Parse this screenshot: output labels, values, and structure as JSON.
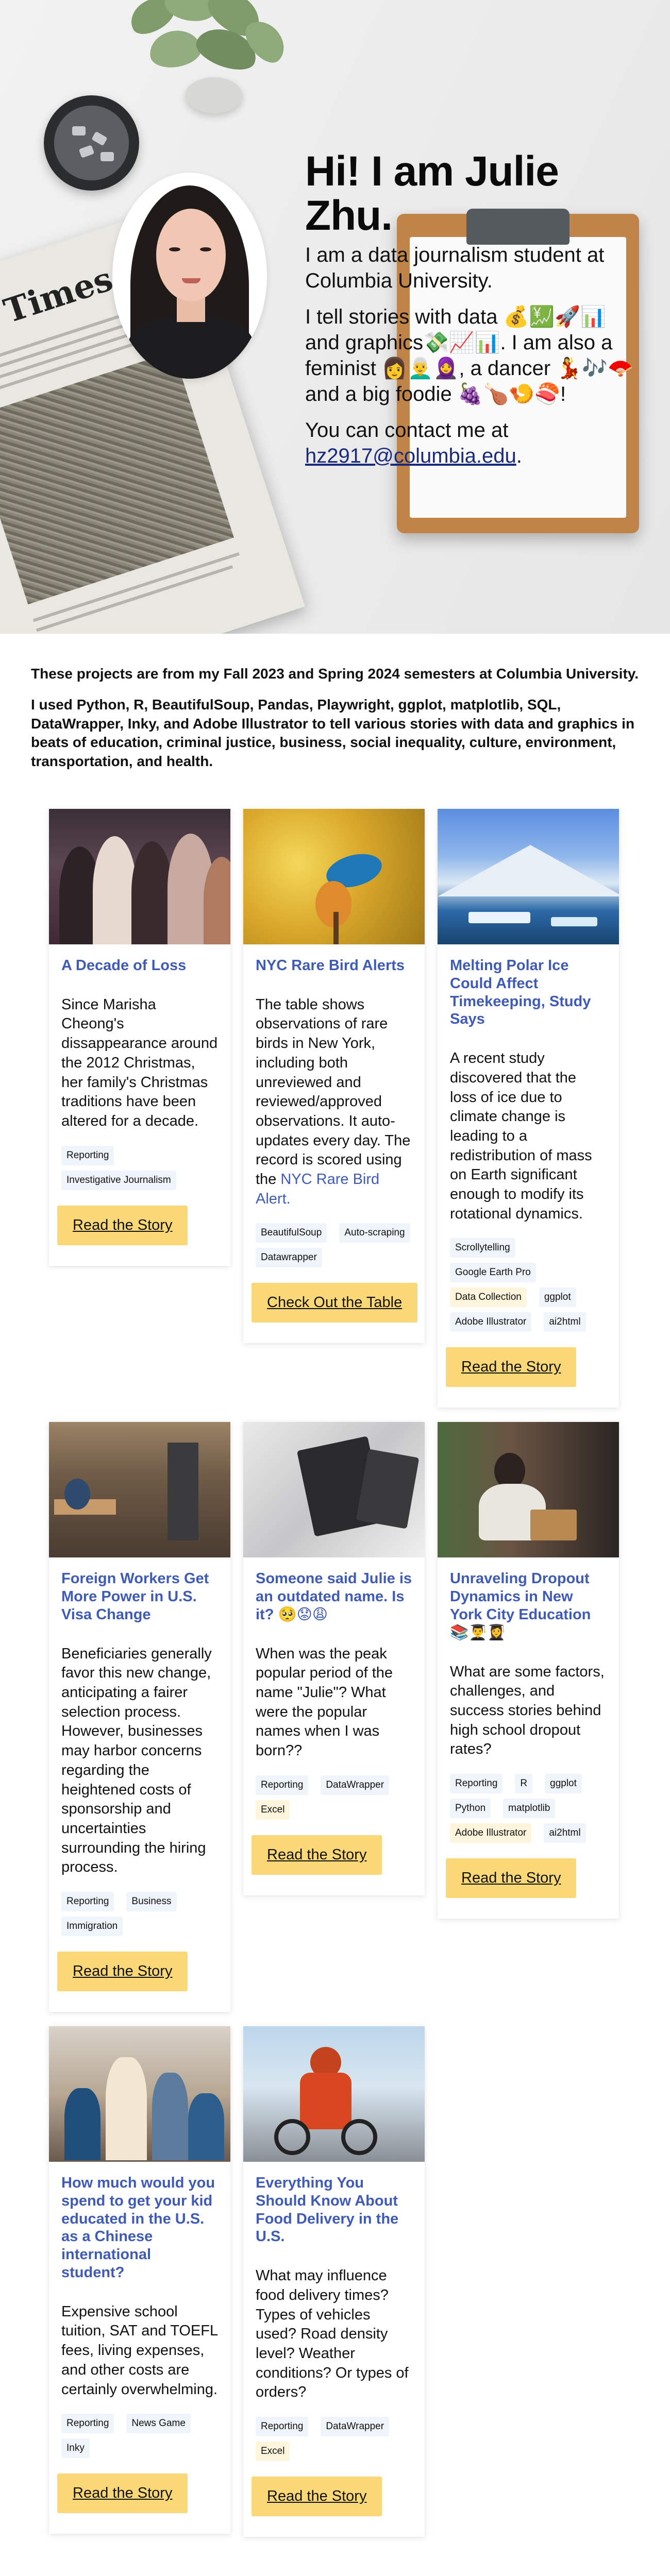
{
  "hero": {
    "heading": "Hi! I am Julie Zhu.",
    "line1": "I am a data journalism student at Columbia University.",
    "line2": "I tell stories with data 💰💹🚀📊 and graphics💸📈📊. I am also a feminist 👩👨‍🦳🧕, a dancer 💃🎶🪭 and a big foodie 🍇🍗🍤🍣!",
    "contact_prefix": "You can contact me at ",
    "email": "hz2917@columbia.edu",
    "contact_suffix": ".",
    "newspaper_masthead": "York Times"
  },
  "about": {
    "p1": "These projects are from my Fall 2023 and Spring 2024 semesters at Columbia University.",
    "p2": "I used Python, R, BeautifulSoup, Pandas, Playwright, ggplot, matplotlib, SQL, DataWrapper, Inky, and Adobe Illustrator to tell various stories with data and graphics in beats of education, criminal justice, business, social inequality, culture, environment, transportation, and health."
  },
  "cards": [
    {
      "title": "A Decade of Loss",
      "desc": "Since Marisha Cheong's dissappearance around the 2012 Christmas, her family's Christmas traditions have been altered for a decade.",
      "tags": [
        {
          "label": "Reporting",
          "color": "blue"
        },
        {
          "label": "Investigative Journalism",
          "color": "blue"
        }
      ],
      "button": "Read the Story"
    },
    {
      "title": "NYC Rare Bird Alerts",
      "desc": "The table shows observations of rare birds in New York, including both unreviewed and reviewed/approved observations. It auto-updates every day. The record is scored using the ",
      "desc_link": "NYC Rare Bird Alert.",
      "tags": [
        {
          "label": "BeautifulSoup",
          "color": "blue"
        },
        {
          "label": "Auto-scraping",
          "color": "blue"
        },
        {
          "label": "Datawrapper",
          "color": "blue"
        }
      ],
      "button": "Check Out the Table"
    },
    {
      "title": "Melting Polar Ice Could Affect Timekeeping, Study Says",
      "desc": "A recent study discovered that the loss of ice due to climate change is leading to a redistribution of mass on Earth significant enough to modify its rotational dynamics.",
      "tags": [
        {
          "label": "Scrollytelling",
          "color": "blue"
        },
        {
          "label": "Google Earth Pro",
          "color": "blue"
        },
        {
          "label": "Data Collection",
          "color": "yellow"
        },
        {
          "label": "ggplot",
          "color": "blue"
        },
        {
          "label": "Adobe Illustrator",
          "color": "blue"
        },
        {
          "label": "ai2html",
          "color": "blue"
        }
      ],
      "button": "Read the Story"
    },
    {
      "title": "Foreign Workers Get More Power in U.S. Visa Change",
      "desc": "Beneficiaries generally favor this new change, anticipating a fairer selection process. However, businesses may harbor concerns regarding the heightened costs of sponsorship and uncertainties surrounding the hiring process.",
      "tags": [
        {
          "label": "Reporting",
          "color": "blue"
        },
        {
          "label": "Business",
          "color": "blue"
        },
        {
          "label": "Immigration",
          "color": "blue"
        }
      ],
      "button": "Read the Story"
    },
    {
      "title": "Someone said Julie is an outdated name. Is it? 🥺😟😩",
      "desc": "When was the peak popular period of the name \"Julie\"? What were the popular names when I was born??",
      "tags": [
        {
          "label": "Reporting",
          "color": "blue"
        },
        {
          "label": "DataWrapper",
          "color": "blue"
        },
        {
          "label": "Excel",
          "color": "yellow"
        }
      ],
      "button": "Read the Story"
    },
    {
      "title": "Unraveling Dropout Dynamics in New York City Education 📚👨‍🎓👩‍🎓",
      "desc": "What are some factors, challenges, and success stories behind high school dropout rates?",
      "tags": [
        {
          "label": "Reporting",
          "color": "blue"
        },
        {
          "label": "R",
          "color": "blue"
        },
        {
          "label": "ggplot",
          "color": "blue"
        },
        {
          "label": "Python",
          "color": "blue"
        },
        {
          "label": "matplotlib",
          "color": "blue"
        },
        {
          "label": "Adobe Illustrator",
          "color": "yellow"
        },
        {
          "label": "ai2html",
          "color": "blue"
        }
      ],
      "button": "Read the Story"
    },
    {
      "title": "How much would you spend to get your kid educated in the U.S. as a Chinese international student?",
      "desc": "Expensive school tuition, SAT and TOEFL fees, living expenses, and other costs are certainly overwhelming.",
      "tags": [
        {
          "label": "Reporting",
          "color": "blue"
        },
        {
          "label": "News Game",
          "color": "blue"
        },
        {
          "label": "Inky",
          "color": "blue"
        }
      ],
      "button": "Read the Story"
    },
    {
      "title": "Everything You Should Know About Food Delivery in the U.S.",
      "desc": "What may influence food delivery times? Types of vehicles used? Road density level? Weather conditions? Or types of orders?",
      "tags": [
        {
          "label": "Reporting",
          "color": "blue"
        },
        {
          "label": "DataWrapper",
          "color": "blue"
        },
        {
          "label": "Excel",
          "color": "yellow"
        }
      ],
      "button": "Read the Story"
    }
  ]
}
